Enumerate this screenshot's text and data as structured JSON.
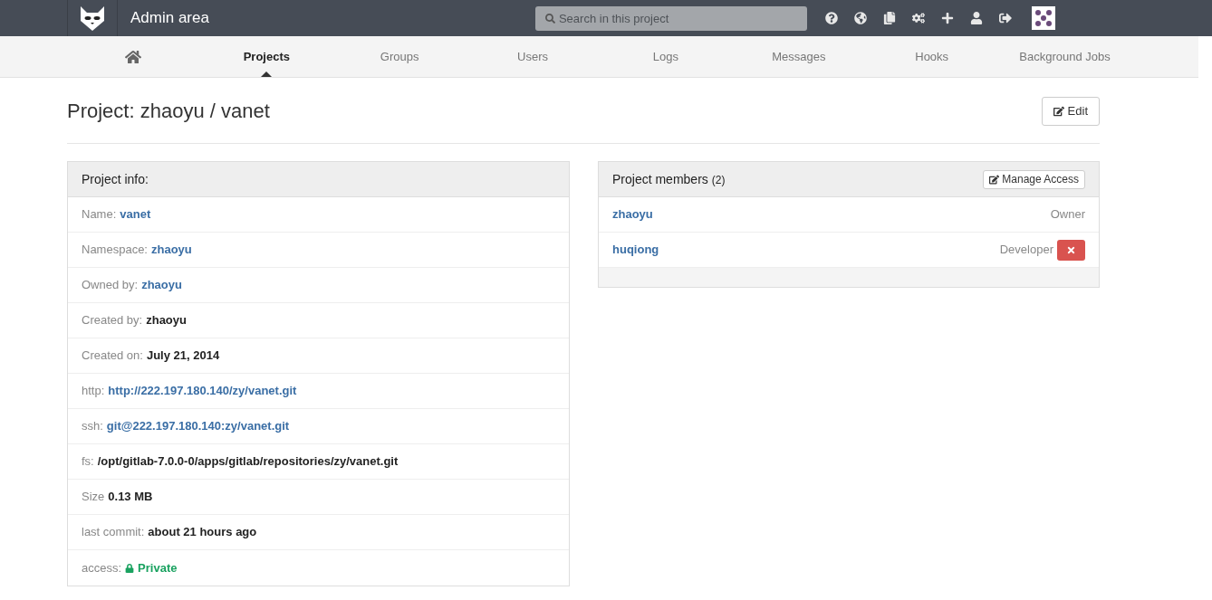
{
  "header": {
    "title": "Admin area",
    "search": {
      "placeholder": "Search in this project"
    }
  },
  "nav": [
    {
      "kind": "icon",
      "selected": false
    },
    {
      "kind": "text",
      "label": "Projects",
      "selected": true
    },
    {
      "kind": "text",
      "label": "Groups",
      "selected": false
    },
    {
      "kind": "text",
      "label": "Users",
      "selected": false
    },
    {
      "kind": "text",
      "label": "Logs",
      "selected": false
    },
    {
      "kind": "text",
      "label": "Messages",
      "selected": false
    },
    {
      "kind": "text",
      "label": "Hooks",
      "selected": false
    },
    {
      "kind": "text",
      "label": "Background Jobs",
      "selected": false
    }
  ],
  "page_title": "Project: zhaoyu / vanet",
  "edit_button": "Edit",
  "info_panel": {
    "title": "Project info:",
    "rows": [
      {
        "label": "Name:",
        "value": "vanet",
        "kind": "link"
      },
      {
        "label": "Namespace:",
        "value": "zhaoyu",
        "kind": "link"
      },
      {
        "label": "Owned by:",
        "value": "zhaoyu",
        "kind": "link"
      },
      {
        "label": "Created by:",
        "value": "zhaoyu",
        "kind": "bold"
      },
      {
        "label": "Created on:",
        "value": "July 21, 2014",
        "kind": "bold"
      },
      {
        "label": "http:",
        "value": "http://222.197.180.140/zy/vanet.git",
        "kind": "link"
      },
      {
        "label": "ssh:",
        "value": "git@222.197.180.140:zy/vanet.git",
        "kind": "link"
      },
      {
        "label": "fs:",
        "value": "/opt/gitlab-7.0.0-0/apps/gitlab/repositories/zy/vanet.git",
        "kind": "bold"
      },
      {
        "label": "Size",
        "value": "0.13 MB",
        "kind": "bold"
      },
      {
        "label": "last commit:",
        "value": "about 21 hours ago",
        "kind": "bold"
      },
      {
        "label": "access:",
        "value": "Private",
        "kind": "access"
      }
    ]
  },
  "members_panel": {
    "title": "Project members",
    "count": "(2)",
    "manage_button": "Manage Access",
    "members": [
      {
        "name": "zhaoyu",
        "role": "Owner",
        "removable": false
      },
      {
        "name": "huqiong",
        "role": "Developer",
        "removable": true
      }
    ]
  }
}
